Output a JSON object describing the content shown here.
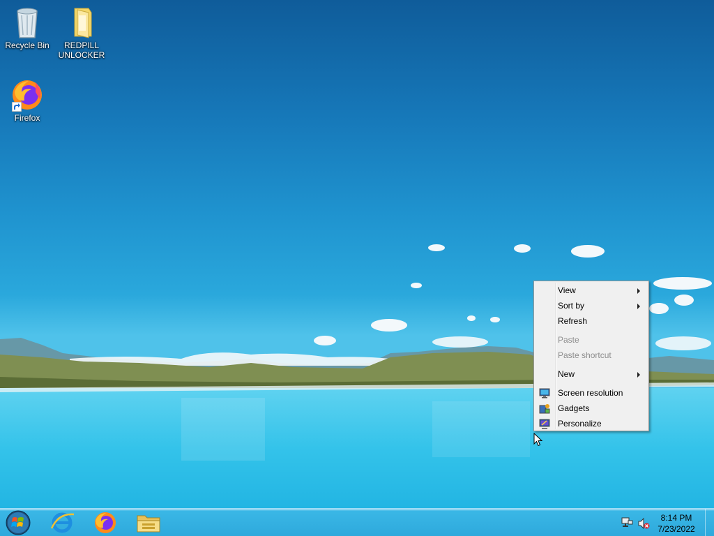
{
  "desktop": {
    "icons": [
      {
        "label": "Recycle Bin",
        "icon": "recycle-bin-icon"
      },
      {
        "label": "REDPILL\nUNLOCKER",
        "icon": "folder-icon"
      },
      {
        "label": "Firefox",
        "icon": "firefox-icon",
        "shortcut": true
      }
    ]
  },
  "context_menu": {
    "items": [
      {
        "label": "View",
        "submenu": true,
        "enabled": true
      },
      {
        "label": "Sort by",
        "submenu": true,
        "enabled": true
      },
      {
        "label": "Refresh",
        "submenu": false,
        "enabled": true
      },
      {
        "label": "Paste",
        "submenu": false,
        "enabled": false
      },
      {
        "label": "Paste shortcut",
        "submenu": false,
        "enabled": false
      },
      {
        "label": "New",
        "submenu": true,
        "enabled": true
      },
      {
        "label": "Screen resolution",
        "icon": "screen-resolution-icon",
        "enabled": true
      },
      {
        "label": "Gadgets",
        "icon": "gadgets-icon",
        "enabled": true
      },
      {
        "label": "Personalize",
        "icon": "personalize-icon",
        "enabled": true
      }
    ]
  },
  "taskbar": {
    "pinned": [
      "start-orb-icon",
      "internet-explorer-icon",
      "firefox-icon",
      "file-explorer-icon"
    ],
    "tray_icons": [
      "network-icon",
      "volume-muted-icon"
    ],
    "clock": {
      "time": "8:14 PM",
      "date": "7/23/2022"
    }
  },
  "colors": {
    "menu_background": "#f0f0f0",
    "menu_border": "#979797",
    "disabled_text": "#8d8d8d",
    "taskbar": "#2ea9dc"
  }
}
